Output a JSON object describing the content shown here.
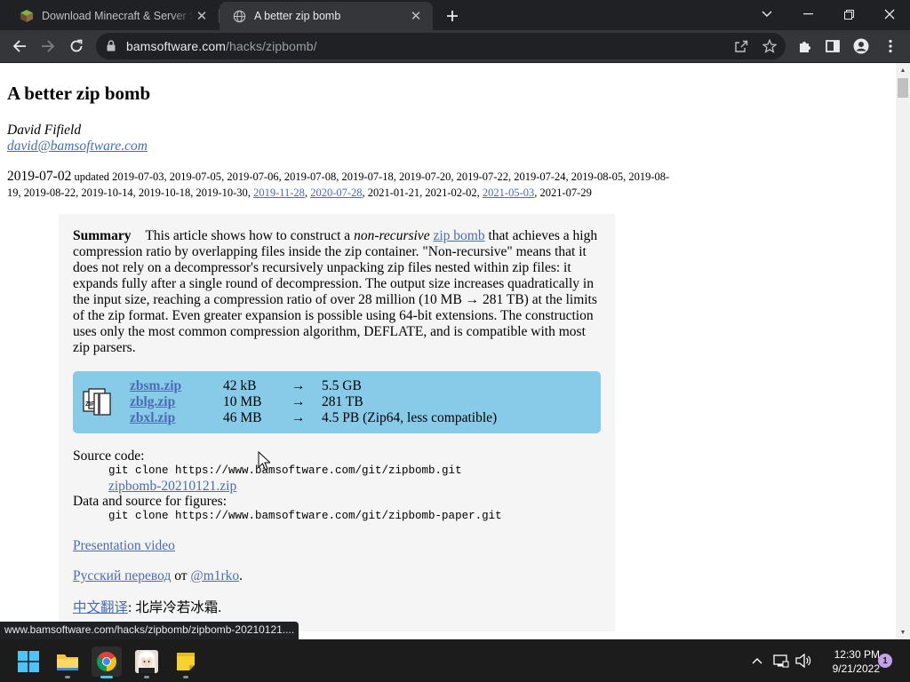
{
  "browser": {
    "tabs": [
      {
        "title": "Download Minecraft & Server Software",
        "icon": "minecraft-icon",
        "active": false
      },
      {
        "title": "A better zip bomb",
        "icon": "globe-icon",
        "active": true
      }
    ],
    "url_host": "bamsoftware.com",
    "url_path": "/hacks/zipbomb/"
  },
  "page": {
    "title": "A better zip bomb",
    "author": "David Fifield",
    "email": "david@bamsoftware.com",
    "date": "2019-07-02",
    "updated_label": "updated",
    "updates": [
      {
        "text": "2019-07-03",
        "link": false
      },
      {
        "text": "2019-07-05",
        "link": false
      },
      {
        "text": "2019-07-06",
        "link": false
      },
      {
        "text": "2019-07-08",
        "link": false
      },
      {
        "text": "2019-07-18",
        "link": false
      },
      {
        "text": "2019-07-20",
        "link": false
      },
      {
        "text": "2019-07-22",
        "link": false
      },
      {
        "text": "2019-07-24",
        "link": false
      },
      {
        "text": "2019-08-05",
        "link": false
      },
      {
        "text": "2019-08-19",
        "link": false
      },
      {
        "text": "2019-08-22",
        "link": false
      },
      {
        "text": "2019-10-14",
        "link": false
      },
      {
        "text": "2019-10-18",
        "link": false
      },
      {
        "text": "2019-10-30",
        "link": false
      },
      {
        "text": "2019-11-28",
        "link": true
      },
      {
        "text": "2020-07-28",
        "link": true
      },
      {
        "text": "2021-01-21",
        "link": false
      },
      {
        "text": "2021-02-02",
        "link": false
      },
      {
        "text": "2021-05-03",
        "link": true
      },
      {
        "text": "2021-07-29",
        "link": false
      }
    ],
    "summary": {
      "heading": "Summary",
      "p1": "This article shows how to construct a ",
      "em": "non-recursive",
      "p2": " ",
      "link": "zip bomb",
      "p3": " that achieves a high compression ratio by overlapping files inside the zip container. \"Non-recursive\" means that it does not rely on a decompressor's recursively unpacking zip files nested within zip files: it expands fully after a single round of decompression. The output size increases quadratically in the input size, reaching a compression ratio of over 28 million (10 MB → 281 TB) at the limits of the zip format. Even greater expansion is possible using 64-bit extensions. The construction uses only the most common compression algorithm, DEFLATE, and is compatible with most zip parsers."
    },
    "downloads": [
      {
        "file": "zbsm.zip",
        "size": "42 kB",
        "arrow": "→",
        "expanded": "5.5 GB"
      },
      {
        "file": "zblg.zip",
        "size": "10 MB",
        "arrow": "→",
        "expanded": "281 TB"
      },
      {
        "file": "zbxl.zip",
        "size": "46 MB",
        "arrow": "→",
        "expanded": "4.5 PB (Zip64, less compatible)"
      }
    ],
    "source_label": "Source code:",
    "source_cmd": "git clone https://www.bamsoftware.com/git/zipbomb.git",
    "source_zip": "zipbomb-20210121.zip",
    "data_label": "Data and source for figures:",
    "data_cmd": "git clone https://www.bamsoftware.com/git/zipbomb-paper.git",
    "presentation": "Presentation video",
    "russian_link": "Русский перевод",
    "russian_mid": " от ",
    "russian_author": "@m1rko",
    "russian_end": ".",
    "chinese_link": "中文翻译",
    "chinese_rest": ": 北岸冷若冰霜."
  },
  "status_url": "www.bamsoftware.com/hacks/zipbomb/zipbomb-20210121....",
  "taskbar": {
    "apps": [
      "start-icon",
      "file-explorer-icon",
      "chrome-icon",
      "anime-avatar-app-icon",
      "sticky-notes-icon"
    ],
    "time": "12:30 PM",
    "date": "9/21/2022",
    "notifications": "1"
  },
  "colors": {
    "link": "#4a6cb3",
    "download_box": "#88cbe9",
    "summary_bg": "#f5f5f5"
  }
}
